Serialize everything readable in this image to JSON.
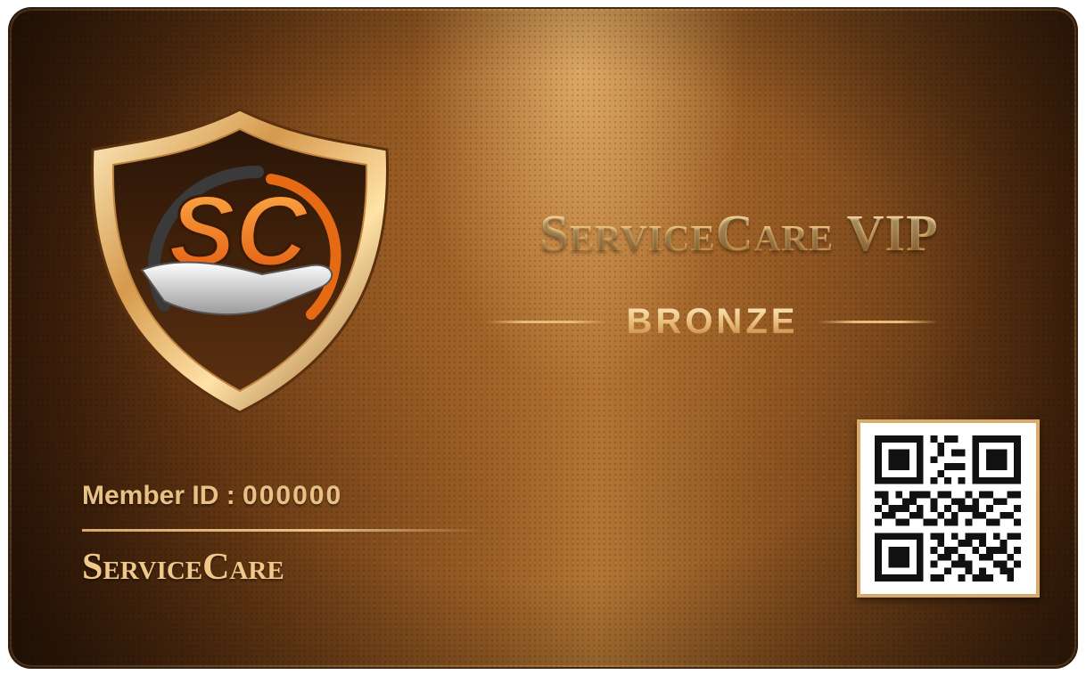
{
  "card": {
    "logo_letters": "SC",
    "brand_title": "ServiceCare VIP",
    "tier": "BRONZE",
    "member_label": "Member ID : ",
    "member_id": "000000",
    "issuer": "ServiceCare"
  },
  "icons": {
    "logo": "shield-hand-logo-icon",
    "qr": "qr-code-icon"
  },
  "colors": {
    "bronze_dark": "#3b1d09",
    "bronze_mid": "#9a5e25",
    "gold_text": "#f0c98a",
    "logo_orange": "#f07a1a"
  }
}
